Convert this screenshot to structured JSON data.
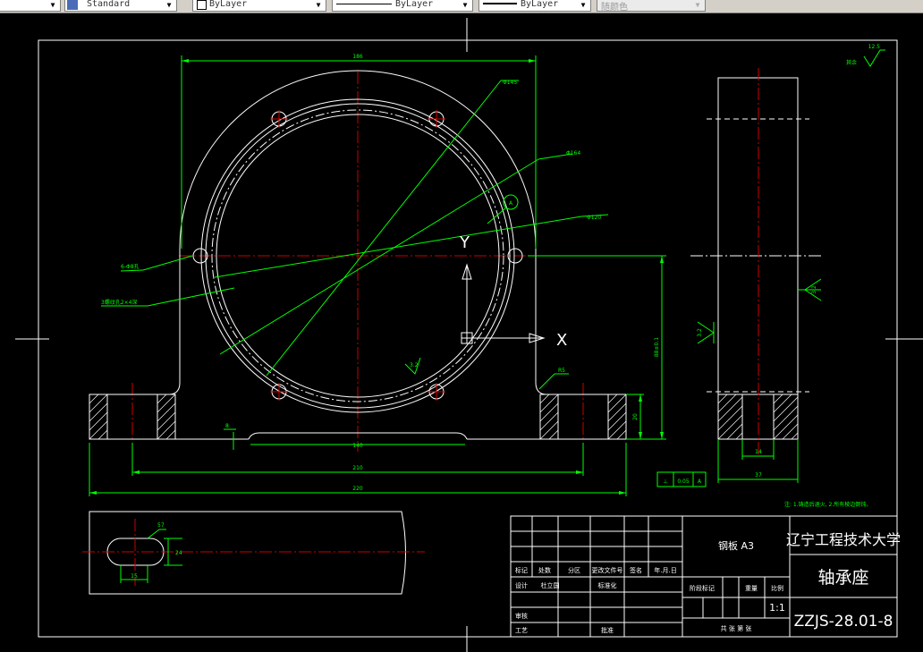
{
  "toolbar": {
    "textstyle": "Standard",
    "layer": "ByLayer",
    "linetype": "ByLayer",
    "lineweight": "ByLayer",
    "color": "随颜色"
  },
  "drawing": {
    "dims": {
      "top_width": "186",
      "d_outer": "Φ145",
      "d_mid": "Φ164",
      "d_bolt": "Φ120",
      "holes": "6-Φ8孔",
      "thread": "3螺纹孔2×4深",
      "base_gap": "140",
      "base_inner": "210",
      "base_total": "220",
      "height": "88±0.1",
      "base_h": "20",
      "left_off": "8",
      "r5": "R5",
      "roughness_small": "3.2",
      "side_inner": "14",
      "side_total": "37",
      "side_r_l": "3.2",
      "side_r_r": "3.2",
      "slot_w": "57",
      "slot_h": "24",
      "slot_l": "15",
      "datum": "A",
      "tol_sym": "⊥",
      "tol_val": "0.05",
      "tol_ref": "A",
      "corner_label": "其余",
      "corner_val": "12.5",
      "note": "注: 1.铸造后退火, 2.所有棱边倒钝。"
    },
    "axis": {
      "y": "Y",
      "x": "X"
    },
    "titleblock": {
      "material": "钢板 A3",
      "school": "辽宁工程技术大学",
      "part_name": "轴承座",
      "drawing_no": "ZZJS-28.01-8",
      "scale": "1:1",
      "r_stage": "阶段标记",
      "r_weight": "重量",
      "r_scale": "比例",
      "r_sheets": "共 张 第 张",
      "h_mark": "标记",
      "h_count": "处数",
      "h_zone": "分区",
      "h_docno": "更改文件号",
      "h_sign": "签名",
      "h_date": "年.月.日",
      "design": "设计",
      "designer": "杜立国",
      "std": "标准化",
      "review": "审核",
      "process": "工艺",
      "approve": "批准"
    }
  }
}
